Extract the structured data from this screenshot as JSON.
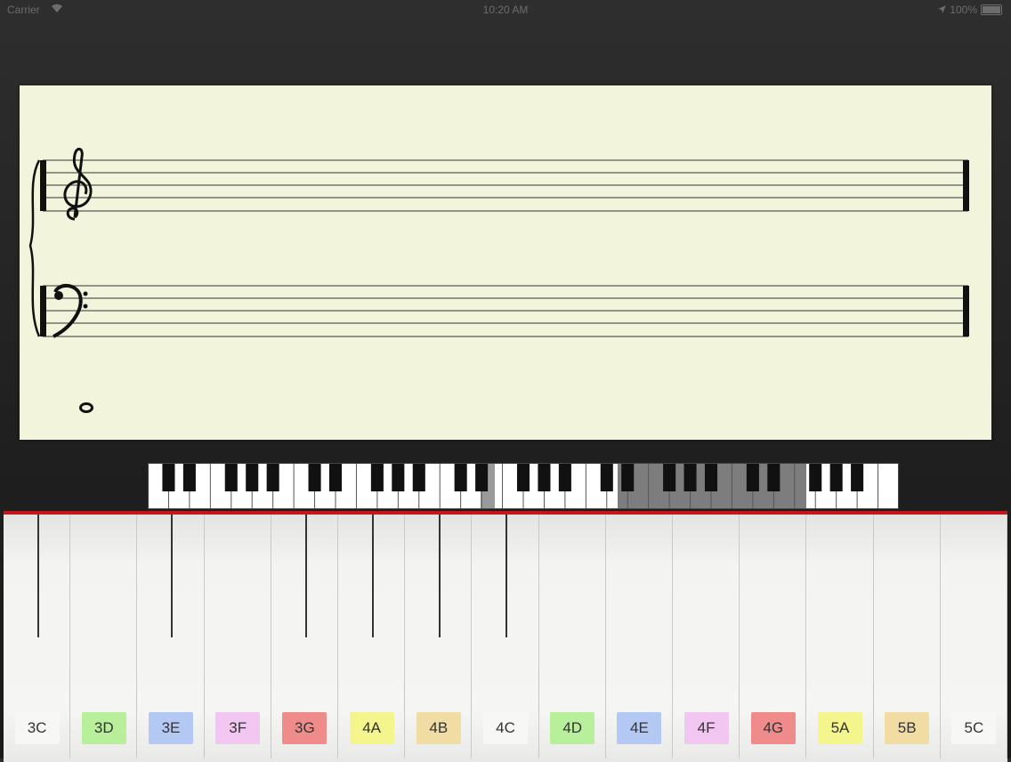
{
  "status_bar": {
    "carrier": "Carrier",
    "wifi_icon": "wifi-icon",
    "time": "10:20 AM",
    "location_icon": "location-arrow-icon",
    "battery_percent": "100%"
  },
  "score": {
    "clefs": [
      "treble-clef",
      "bass-clef"
    ],
    "note_shown": "whole-note"
  },
  "mini_keyboard": {
    "white_key_count": 36,
    "highlighted_range": "visible-octave-selection"
  },
  "keyboard": {
    "accent_color": "#c81515",
    "keys": [
      {
        "label": "3C",
        "color": "#f7f7f5"
      },
      {
        "label": "3D",
        "color": "#b8ef9a"
      },
      {
        "label": "3E",
        "color": "#b4c8f4"
      },
      {
        "label": "3F",
        "color": "#f1c6f1"
      },
      {
        "label": "3G",
        "color": "#ef8b8b"
      },
      {
        "label": "4A",
        "color": "#f5f58e"
      },
      {
        "label": "4B",
        "color": "#f1dca4"
      },
      {
        "label": "4C",
        "color": "#f7f7f5"
      },
      {
        "label": "4D",
        "color": "#b8ef9a"
      },
      {
        "label": "4E",
        "color": "#b4c8f4"
      },
      {
        "label": "4F",
        "color": "#f1c6f1"
      },
      {
        "label": "4G",
        "color": "#ef8b8b"
      },
      {
        "label": "5A",
        "color": "#f5f58e"
      },
      {
        "label": "5B",
        "color": "#f1dca4"
      },
      {
        "label": "5C",
        "color": "#f7f7f5"
      }
    ]
  }
}
